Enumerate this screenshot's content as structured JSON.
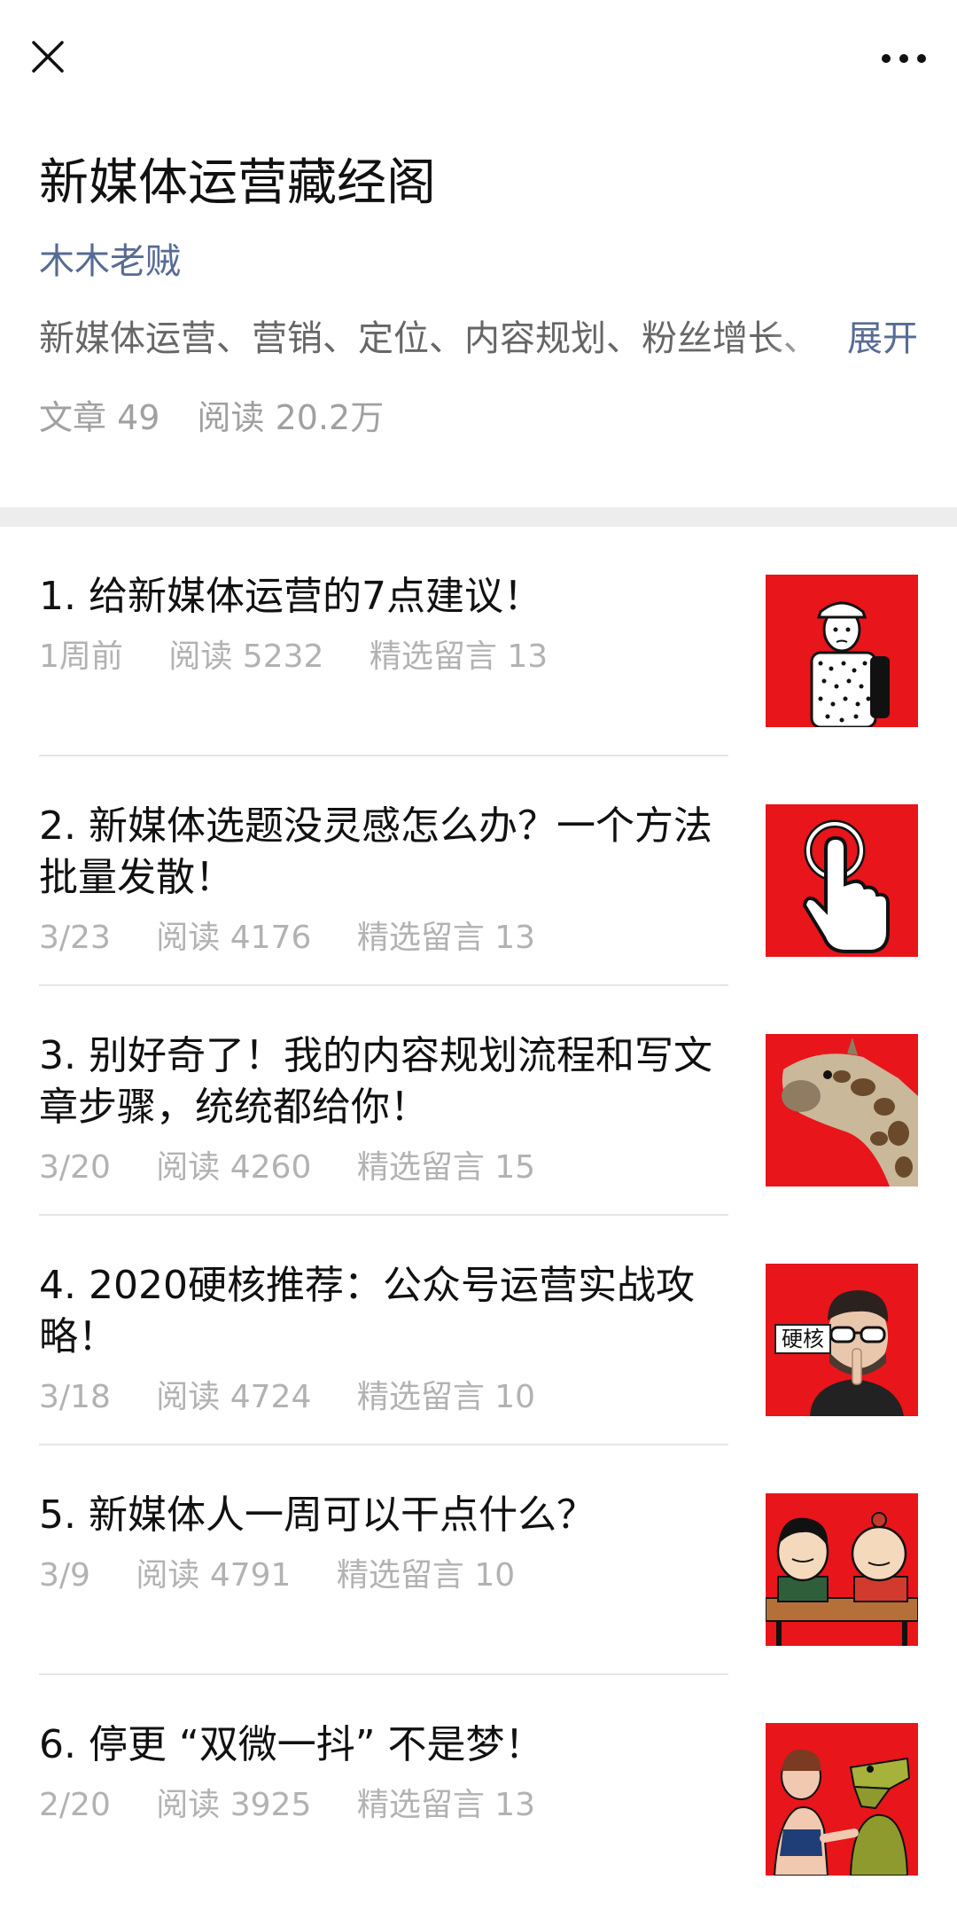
{
  "colors": {
    "accent": "#576b95",
    "thumb_red": "#e8151b",
    "meta": "#b2b2b2"
  },
  "topbar": {
    "close_icon": "close-icon",
    "more_icon": "more-dots-icon"
  },
  "album": {
    "title": "新媒体运营藏经阁",
    "author": "木木老贼",
    "description": "新媒体运营、营销、定位、内容规划、粉丝增长、",
    "expand_label": "展开",
    "articles_stat": "文章 49",
    "reads_stat": "阅读 20.2万"
  },
  "articles": [
    {
      "title": "1. 给新媒体运营的7点建议！",
      "date": "1周前",
      "reads": "阅读 5232",
      "comments": "精选留言 13",
      "thumb": "backpack-man-illustration"
    },
    {
      "title": "2. 新媒体选题没灵感怎么办？一个方法批量发散！",
      "date": "3/23",
      "reads": "阅读 4176",
      "comments": "精选留言 13",
      "thumb": "pointing-hand-illustration"
    },
    {
      "title": "3. 别好奇了！我的内容规划流程和写文章步骤，统统都给你！",
      "date": "3/20",
      "reads": "阅读 4260",
      "comments": "精选留言 15",
      "thumb": "giraffe-photo"
    },
    {
      "title": "4. 2020硬核推荐：公众号运营实战攻略！",
      "date": "3/18",
      "reads": "阅读 4724",
      "comments": "精选留言 10",
      "thumb": "shush-man-photo",
      "thumb_tag": "硬核"
    },
    {
      "title": "5. 新媒体人一周可以干点什么？",
      "date": "3/9",
      "reads": "阅读 4791",
      "comments": "精选留言 10",
      "thumb": "meme-faces-illustration"
    },
    {
      "title": "6. 停更 “双微一抖” 不是梦！",
      "date": "2/20",
      "reads": "阅读 3925",
      "comments": "精选留言 13",
      "thumb": "crocodile-cartoon-illustration"
    }
  ]
}
